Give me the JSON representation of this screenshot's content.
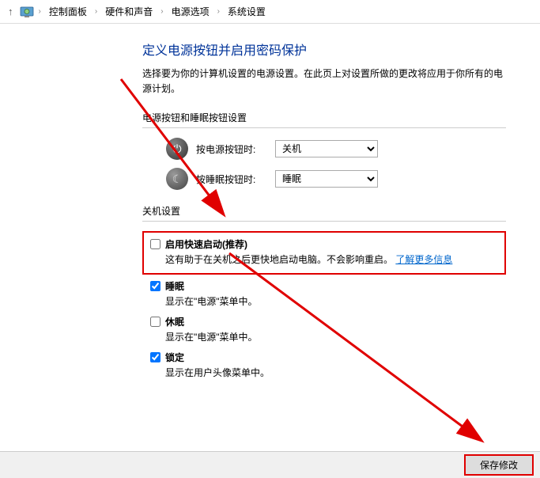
{
  "breadcrumb": {
    "items": [
      "控制面板",
      "硬件和声音",
      "电源选项",
      "系统设置"
    ]
  },
  "page": {
    "title": "定义电源按钮并启用密码保护",
    "description": "选择要为你的计算机设置的电源设置。在此页上对设置所做的更改将应用于你所有的电源计划。"
  },
  "buttons_section": {
    "heading": "电源按钮和睡眠按钮设置",
    "power_label": "按电源按钮时:",
    "power_value": "关机",
    "sleep_label": "按睡眠按钮时:",
    "sleep_value": "睡眠"
  },
  "shutdown_section": {
    "heading": "关机设置",
    "fast_startup": {
      "label": "启用快速启动(推荐)",
      "desc_prefix": "这有助于在关机之后更快地启动电脑。不会影响重启。",
      "link": "了解更多信息",
      "checked": false
    },
    "sleep": {
      "label": "睡眠",
      "desc": "显示在\"电源\"菜单中。",
      "checked": true
    },
    "hibernate": {
      "label": "休眠",
      "desc": "显示在\"电源\"菜单中。",
      "checked": false
    },
    "lock": {
      "label": "锁定",
      "desc": "显示在用户头像菜单中。",
      "checked": true
    }
  },
  "footer": {
    "save": "保存修改"
  }
}
